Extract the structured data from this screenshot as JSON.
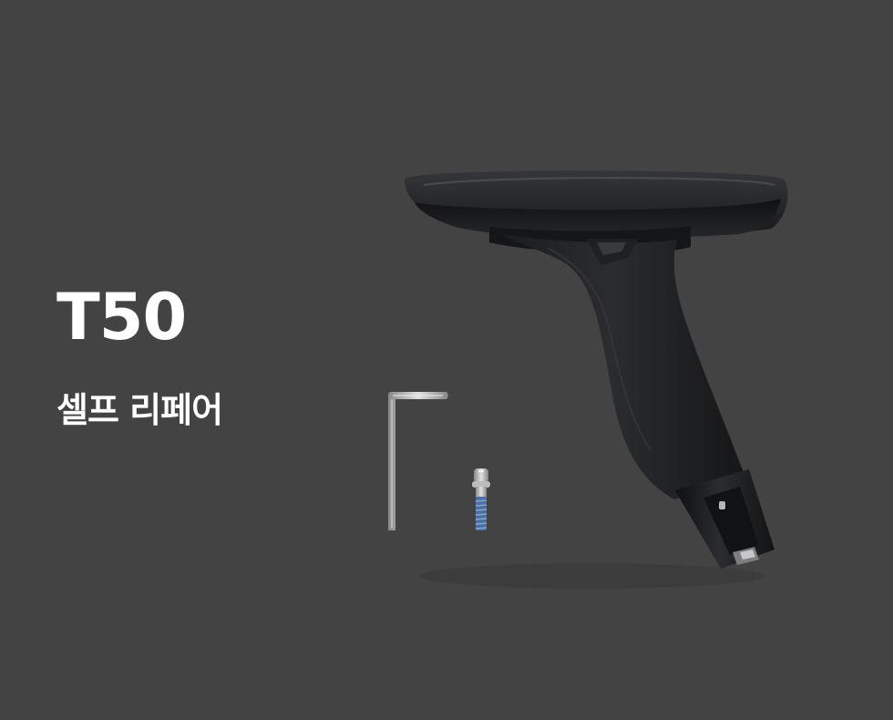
{
  "heading": {
    "model": "T50",
    "subtitle": "셀프 리페어"
  },
  "product_image": {
    "items": [
      "armrest-icon",
      "hex-key-icon",
      "screw-icon"
    ]
  },
  "colors": {
    "background": "#434343",
    "text": "#ffffff",
    "armrest": "#1f2022",
    "metal": "#b9b9b9",
    "thread_lock": "#4d6ea3"
  }
}
